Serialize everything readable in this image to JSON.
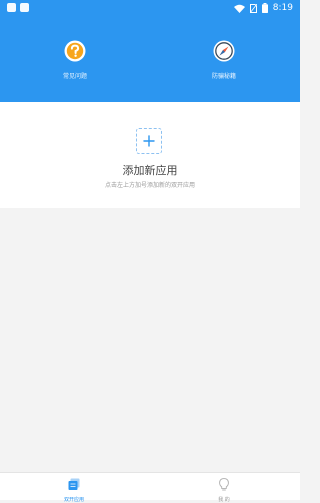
{
  "status_bar": {
    "time": "8:19"
  },
  "header": {
    "items": [
      {
        "label": "常见问题",
        "icon": "question-icon"
      },
      {
        "label": "防骗秘籍",
        "icon": "compass-icon"
      }
    ]
  },
  "add_app": {
    "title": "添加新应用",
    "subtitle": "点击左上方加号添加新的双开应用",
    "icon": "plus-icon"
  },
  "bottom_nav": {
    "items": [
      {
        "label": "双开应用",
        "icon": "apps-icon",
        "active": true
      },
      {
        "label": "我 的",
        "icon": "bulb-icon",
        "active": false
      }
    ]
  },
  "colors": {
    "primary": "#2c96f0",
    "question_icon": "#f7a51c",
    "compass_icon": "#f05a3a"
  }
}
